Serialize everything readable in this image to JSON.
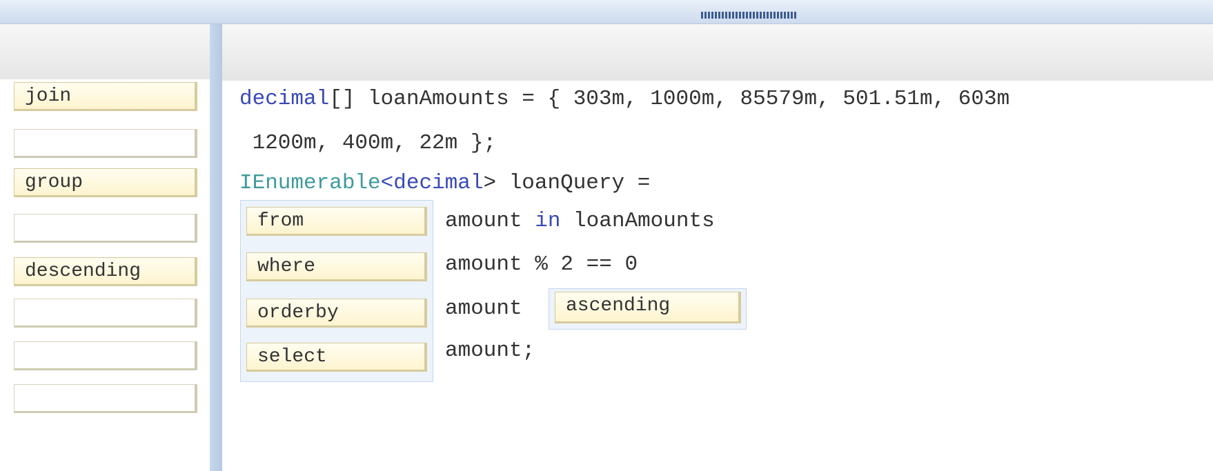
{
  "left_panel": {
    "answer_choices": [
      "join",
      "group",
      "descending"
    ]
  },
  "code": {
    "line1": {
      "kw": "decimal",
      "rest": "[] loanAmounts = { 303m, 1000m, 85579m, 501.51m, 603m"
    },
    "line2": " 1200m, 400m, 22m };",
    "line3": {
      "type": "IEnumerable",
      "lt": "<",
      "kw": "decimal",
      "rest": "> loanQuery ="
    },
    "line4": {
      "pre": "amount ",
      "kw": "in",
      "post": " loanAmounts"
    },
    "line5": "amount % 2 == 0",
    "line6": "amount",
    "line7": "amount;"
  },
  "placed_answers": {
    "slot1": "from",
    "slot2": "where",
    "slot3": "orderby",
    "slot4": "select",
    "slot5": "ascending"
  },
  "colors": {
    "keyword": "#3949b8",
    "type": "#3f9a9c",
    "chip_background": "#fdf4cf",
    "target_background": "#edf3fb"
  }
}
